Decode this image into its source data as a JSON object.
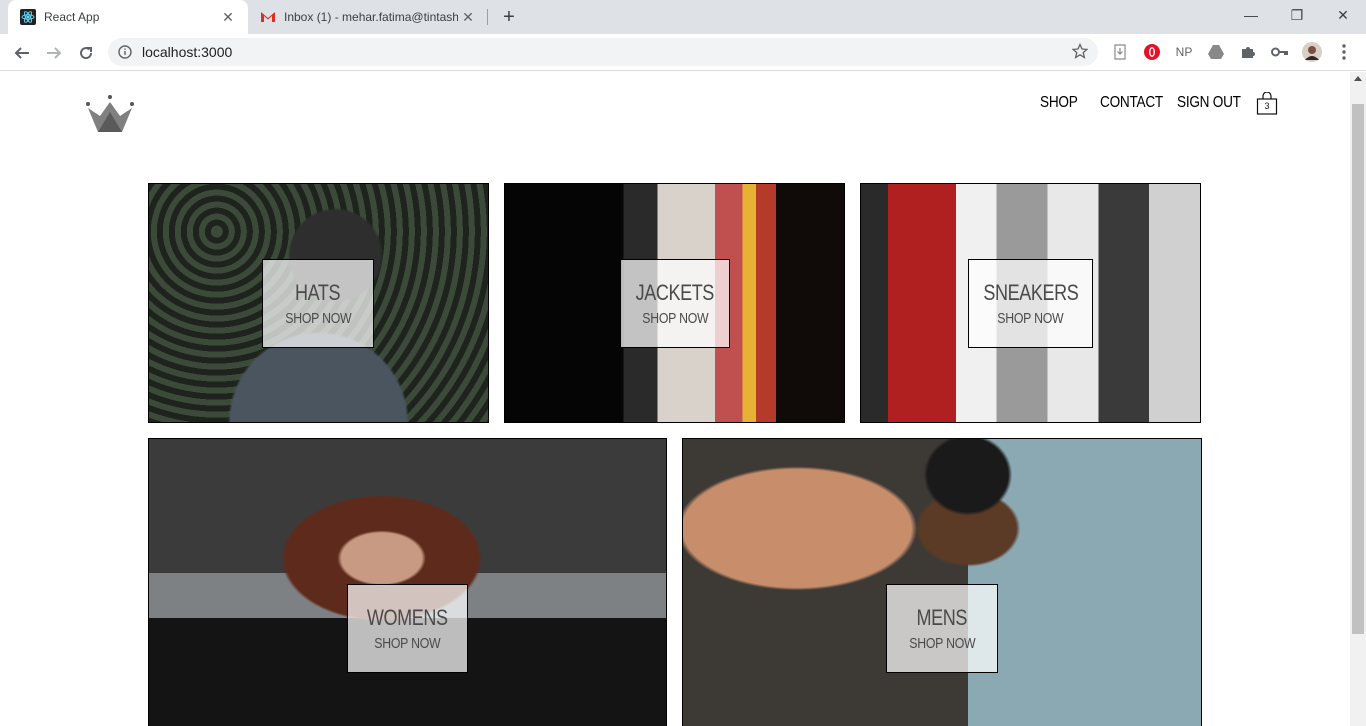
{
  "browser": {
    "tabs": [
      {
        "title": "React App",
        "icon": "react-icon",
        "active": true
      },
      {
        "title": "Inbox (1) - mehar.fatima@tintash",
        "icon": "gmail-icon",
        "active": false
      }
    ],
    "url": "localhost:3000",
    "extensions": [
      "NP"
    ]
  },
  "header": {
    "logo": "crown-icon",
    "nav": [
      "SHOP",
      "CONTACT",
      "SIGN OUT"
    ],
    "cart_count": "3"
  },
  "directory": [
    {
      "title": "HATS",
      "subtitle": "SHOP NOW"
    },
    {
      "title": "JACKETS",
      "subtitle": "SHOP NOW"
    },
    {
      "title": "SNEAKERS",
      "subtitle": "SHOP NOW"
    },
    {
      "title": "WOMENS",
      "subtitle": "SHOP NOW"
    },
    {
      "title": "MENS",
      "subtitle": "SHOP NOW"
    }
  ]
}
